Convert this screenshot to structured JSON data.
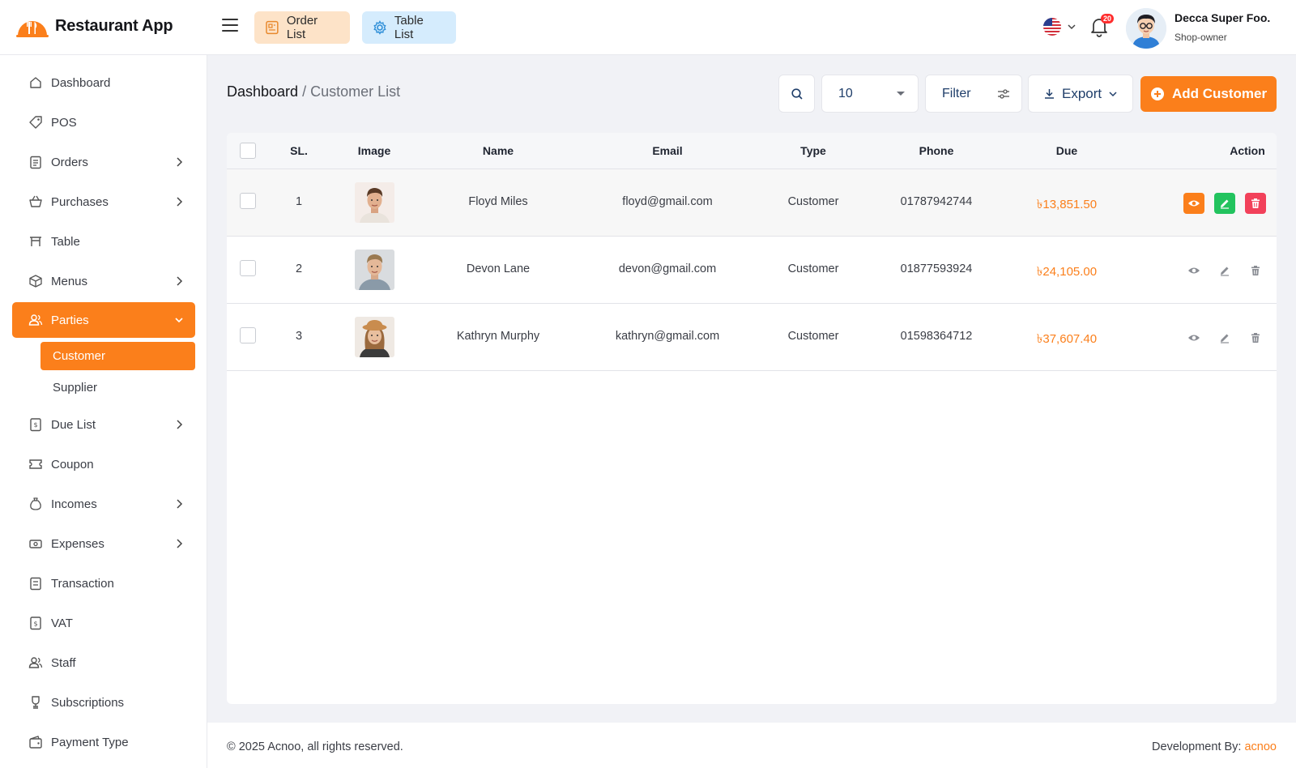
{
  "header": {
    "app_name": "Restaurant App",
    "order_list_label": "Order List",
    "table_list_label": "Table List",
    "notification_count": "20",
    "user_name": "Decca Super Foo.",
    "user_role": "Shop-owner"
  },
  "sidebar": {
    "items": [
      {
        "label": "Dashboard",
        "icon": "home-icon"
      },
      {
        "label": "POS",
        "icon": "tag-icon"
      },
      {
        "label": "Orders",
        "icon": "clipboard-icon"
      },
      {
        "label": "Purchases",
        "icon": "basket-icon"
      },
      {
        "label": "Table",
        "icon": "table-icon"
      },
      {
        "label": "Menus",
        "icon": "box-icon"
      },
      {
        "label": "Parties",
        "icon": "users-icon"
      },
      {
        "label": "Due List",
        "icon": "receipt-icon"
      },
      {
        "label": "Coupon",
        "icon": "ticket-icon"
      },
      {
        "label": "Incomes",
        "icon": "moneybag-icon"
      },
      {
        "label": "Expenses",
        "icon": "cash-icon"
      },
      {
        "label": "Transaction",
        "icon": "list-icon"
      },
      {
        "label": "VAT",
        "icon": "dollar-doc-icon"
      },
      {
        "label": "Staff",
        "icon": "users-icon"
      },
      {
        "label": "Subscriptions",
        "icon": "trophy-icon"
      },
      {
        "label": "Payment Type",
        "icon": "wallet-icon"
      }
    ],
    "sub_items": [
      {
        "label": "Customer"
      },
      {
        "label": "Supplier"
      }
    ]
  },
  "breadcrumb": {
    "root": "Dashboard",
    "separator": "/",
    "current": "Customer List"
  },
  "toolbar": {
    "page_size": "10",
    "filter_label": "Filter",
    "export_label": "Export",
    "add_label": "Add Customer"
  },
  "table": {
    "columns": {
      "sl": "SL.",
      "image": "Image",
      "name": "Name",
      "email": "Email",
      "type": "Type",
      "phone": "Phone",
      "due": "Due",
      "action": "Action"
    },
    "rows": [
      {
        "sl": "1",
        "name": "Floyd Miles",
        "email": "floyd@gmail.com",
        "type": "Customer",
        "phone": "01787942744",
        "due": "৳13,851.50"
      },
      {
        "sl": "2",
        "name": "Devon Lane",
        "email": "devon@gmail.com",
        "type": "Customer",
        "phone": "01877593924",
        "due": "৳24,105.00"
      },
      {
        "sl": "3",
        "name": "Kathryn Murphy",
        "email": "kathryn@gmail.com",
        "type": "Customer",
        "phone": "01598364712",
        "due": "৳37,607.40"
      }
    ]
  },
  "footer": {
    "copyright": "© 2025 Acnoo, all rights reserved.",
    "dev_prefix": "Development By:",
    "dev_brand": "acnoo"
  },
  "colors": {
    "accent": "#fb7f1b",
    "view": "#fb7f1b",
    "edit": "#22c35e",
    "delete": "#f2415a"
  }
}
